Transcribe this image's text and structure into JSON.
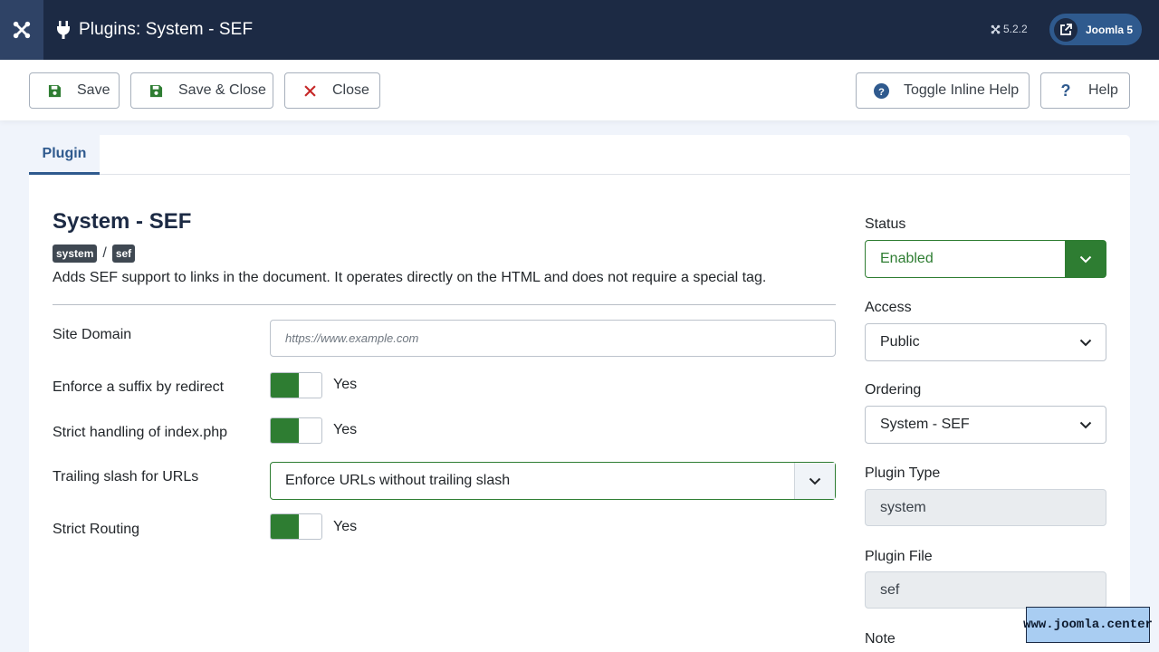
{
  "header": {
    "title": "Plugins: System - SEF",
    "version": "5.2.2",
    "site_link_label": "Joomla 5"
  },
  "toolbar": {
    "save_label": "Save",
    "save_close_label": "Save & Close",
    "close_label": "Close",
    "toggle_help_label": "Toggle Inline Help",
    "help_label": "Help"
  },
  "tabs": [
    {
      "label": "Plugin",
      "active": true
    }
  ],
  "plugin": {
    "title": "System - SEF",
    "folder": "system",
    "element": "sef",
    "separator": "/",
    "description": "Adds SEF support to links in the document. It operates directly on the HTML and does not require a special tag."
  },
  "fields": {
    "site_domain": {
      "label": "Site Domain",
      "placeholder": "https://www.example.com",
      "value": ""
    },
    "enforce_suffix": {
      "label": "Enforce a suffix by redirect",
      "value": "Yes"
    },
    "strict_index": {
      "label": "Strict handling of index.php",
      "value": "Yes"
    },
    "trailing_slash": {
      "label": "Trailing slash for URLs",
      "value": "Enforce URLs without trailing slash"
    },
    "strict_routing": {
      "label": "Strict Routing",
      "value": "Yes"
    }
  },
  "sidebar": {
    "status": {
      "label": "Status",
      "value": "Enabled"
    },
    "access": {
      "label": "Access",
      "value": "Public"
    },
    "ordering": {
      "label": "Ordering",
      "value": "System - SEF"
    },
    "plugin_type": {
      "label": "Plugin Type",
      "value": "system"
    },
    "plugin_file": {
      "label": "Plugin File",
      "value": "sef"
    },
    "note": {
      "label": "Note"
    }
  },
  "watermark": "www.joomla.center",
  "colors": {
    "header_bg": "#1c2a44",
    "accent": "#2f5a8e",
    "success": "#2e7d32",
    "danger": "#c62828"
  }
}
